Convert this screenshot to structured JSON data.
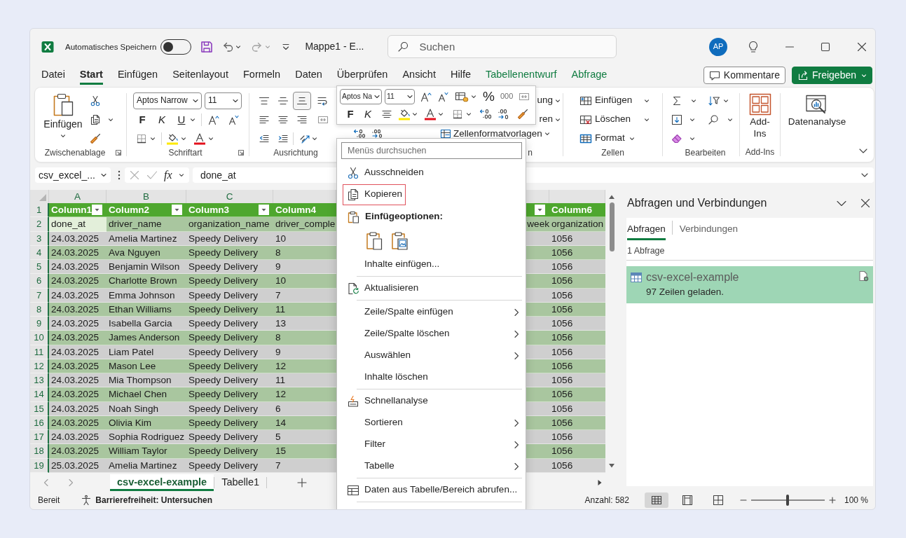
{
  "window": {
    "autosave": {
      "label": "Automatisches Speichern",
      "on": false
    },
    "title": "Mappe1 - E...",
    "search_placeholder": "Suchen",
    "avatar": "AP"
  },
  "ribbon_tabs": [
    {
      "label": "Datei",
      "kind": "standard",
      "selected": false
    },
    {
      "label": "Start",
      "kind": "standard",
      "selected": true
    },
    {
      "label": "Einfügen",
      "kind": "standard",
      "selected": false
    },
    {
      "label": "Seitenlayout",
      "kind": "standard",
      "selected": false
    },
    {
      "label": "Formeln",
      "kind": "standard",
      "selected": false
    },
    {
      "label": "Daten",
      "kind": "standard",
      "selected": false
    },
    {
      "label": "Überprüfen",
      "kind": "standard",
      "selected": false
    },
    {
      "label": "Ansicht",
      "kind": "standard",
      "selected": false
    },
    {
      "label": "Hilfe",
      "kind": "standard",
      "selected": false
    },
    {
      "label": "Tabellenentwurf",
      "kind": "contextual",
      "selected": false
    },
    {
      "label": "Abfrage",
      "kind": "contextual",
      "selected": false
    }
  ],
  "header_buttons": [
    {
      "label": "Kommentare",
      "kind": "outline"
    },
    {
      "label": "Freigeben",
      "kind": "primary"
    }
  ],
  "ribbon": {
    "clipboard": {
      "paste": "Einfügen",
      "label": "Zwischenablage"
    },
    "font": {
      "font_name": "Aptos Narrow",
      "font_size": "11",
      "bold": "F",
      "italic": "K",
      "underline": "U",
      "label": "Schriftart"
    },
    "alignment": {
      "vertical": [
        {
          "kind": "top",
          "selected": false
        },
        {
          "kind": "middle",
          "selected": false
        },
        {
          "kind": "bottom",
          "selected": true
        }
      ],
      "label": "Ausrichtung"
    },
    "styles": {
      "items": [
        "ung",
        "ren",
        "Zellenformatvorlagen"
      ],
      "label": "n"
    },
    "cells": {
      "items": [
        {
          "label": "Einfügen",
          "kind": "insert"
        },
        {
          "label": "Löschen",
          "kind": "delete"
        },
        {
          "label": "Format",
          "kind": "format"
        }
      ],
      "label": "Zellen"
    },
    "editing": {
      "label": "Bearbeiten"
    },
    "addins": {
      "lines": [
        "Add-",
        "Ins"
      ],
      "label": "Add-Ins"
    },
    "analysis": {
      "button": "Datenanalyse"
    }
  },
  "mini_toolbar": {
    "font_name": "Aptos Na",
    "font_size": "11",
    "percent": "%",
    "thousands": "000",
    "bold": "F",
    "italic": "K"
  },
  "formula_bar": {
    "name_box": "csv_excel_...",
    "fx": "fx",
    "value": "done_at"
  },
  "sheet": {
    "columns": [
      {
        "letter": "A",
        "header": "Column1",
        "filter": true
      },
      {
        "letter": "B",
        "header": "Column2",
        "filter": true
      },
      {
        "letter": "C",
        "header": "Column3",
        "filter": true
      },
      {
        "header": "Column4",
        "filter": false
      },
      {
        "filter": true
      },
      {
        "header": "Column6",
        "filter": false
      }
    ],
    "header_row_number": "1",
    "rows": [
      {
        "number": "2",
        "active": true,
        "cells": {
          "column_1": "done_at",
          "column_2": "driver_name",
          "column_3": "organization_name",
          "column_4": "driver_comple",
          "column_5": "week",
          "column_6": "organization"
        }
      },
      {
        "number": "3",
        "active": false,
        "cells": {
          "column_1": "24.03.2025",
          "column_2": "Amelia Martinez",
          "column_3": "Speedy Delivery",
          "column_4": "10",
          "column_6": "1056"
        }
      },
      {
        "number": "4",
        "active": false,
        "cells": {
          "column_1": "24.03.2025",
          "column_2": "Ava Nguyen",
          "column_3": "Speedy Delivery",
          "column_4": "8",
          "column_6": "1056"
        }
      },
      {
        "number": "5",
        "active": false,
        "cells": {
          "column_1": "24.03.2025",
          "column_2": "Benjamin Wilson",
          "column_3": "Speedy Delivery",
          "column_4": "9",
          "column_6": "1056"
        }
      },
      {
        "number": "6",
        "active": false,
        "cells": {
          "column_1": "24.03.2025",
          "column_2": "Charlotte Brown",
          "column_3": "Speedy Delivery",
          "column_4": "10",
          "column_6": "1056"
        }
      },
      {
        "number": "7",
        "active": false,
        "cells": {
          "column_1": "24.03.2025",
          "column_2": "Emma Johnson",
          "column_3": "Speedy Delivery",
          "column_4": "7",
          "column_6": "1056"
        }
      },
      {
        "number": "8",
        "active": false,
        "cells": {
          "column_1": "24.03.2025",
          "column_2": "Ethan Williams",
          "column_3": "Speedy Delivery",
          "column_4": "11",
          "column_6": "1056"
        }
      },
      {
        "number": "9",
        "active": false,
        "cells": {
          "column_1": "24.03.2025",
          "column_2": "Isabella Garcia",
          "column_3": "Speedy Delivery",
          "column_4": "13",
          "column_6": "1056"
        }
      },
      {
        "number": "10",
        "active": false,
        "cells": {
          "column_1": "24.03.2025",
          "column_2": "James Anderson",
          "column_3": "Speedy Delivery",
          "column_4": "8",
          "column_6": "1056"
        }
      },
      {
        "number": "11",
        "active": false,
        "cells": {
          "column_1": "24.03.2025",
          "column_2": "Liam Patel",
          "column_3": "Speedy Delivery",
          "column_4": "9",
          "column_6": "1056"
        }
      },
      {
        "number": "12",
        "active": false,
        "cells": {
          "column_1": "24.03.2025",
          "column_2": "Mason Lee",
          "column_3": "Speedy Delivery",
          "column_4": "12",
          "column_6": "1056"
        }
      },
      {
        "number": "13",
        "active": false,
        "cells": {
          "column_1": "24.03.2025",
          "column_2": "Mia Thompson",
          "column_3": "Speedy Delivery",
          "column_4": "11",
          "column_6": "1056"
        }
      },
      {
        "number": "14",
        "active": false,
        "cells": {
          "column_1": "24.03.2025",
          "column_2": "Michael Chen",
          "column_3": "Speedy Delivery",
          "column_4": "12",
          "column_6": "1056"
        }
      },
      {
        "number": "15",
        "active": false,
        "cells": {
          "column_1": "24.03.2025",
          "column_2": "Noah Singh",
          "column_3": "Speedy Delivery",
          "column_4": "6",
          "column_6": "1056"
        }
      },
      {
        "number": "16",
        "active": false,
        "cells": {
          "column_1": "24.03.2025",
          "column_2": "Olivia Kim",
          "column_3": "Speedy Delivery",
          "column_4": "14",
          "column_6": "1056"
        }
      },
      {
        "number": "17",
        "active": false,
        "cells": {
          "column_1": "24.03.2025",
          "column_2": "Sophia Rodriguez",
          "column_3": "Speedy Delivery",
          "column_4": "5",
          "column_6": "1056"
        }
      },
      {
        "number": "18",
        "active": false,
        "cells": {
          "column_1": "24.03.2025",
          "column_2": "William Taylor",
          "column_3": "Speedy Delivery",
          "column_4": "15",
          "column_6": "1056"
        }
      },
      {
        "number": "19",
        "active": false,
        "cells": {
          "column_1": "25.03.2025",
          "column_2": "Amelia Martinez",
          "column_3": "Speedy Delivery",
          "column_4": "7",
          "column_6": "1056"
        }
      }
    ]
  },
  "sheet_tabs": [
    {
      "label": "csv-excel-example",
      "selected": true
    },
    {
      "label": "Tabelle1",
      "selected": false
    }
  ],
  "queries_panel": {
    "title": "Abfragen und Verbindungen",
    "tabs": [
      {
        "label": "Abfragen",
        "selected": true
      },
      {
        "label": "Verbindungen",
        "selected": false
      }
    ],
    "count": "1 Abfrage",
    "queries": [
      {
        "name": "csv-excel-example",
        "status": "97 Zeilen geladen.",
        "selected": true
      }
    ]
  },
  "context_menu": {
    "search_placeholder": "Menüs durchsuchen",
    "items": [
      {
        "kind": "item",
        "label": "Ausschneiden",
        "submenu": false,
        "highlighted": false
      },
      {
        "kind": "item",
        "label": "Kopieren",
        "submenu": false,
        "highlighted": true
      },
      {
        "kind": "header",
        "label": "Einfügeoptionen:"
      },
      {
        "kind": "paste_options"
      },
      {
        "kind": "item",
        "label": "Inhalte einfügen...",
        "submenu": false,
        "highlighted": false
      },
      {
        "kind": "separator"
      },
      {
        "kind": "item",
        "label": "Aktualisieren",
        "submenu": false,
        "highlighted": false
      },
      {
        "kind": "separator"
      },
      {
        "kind": "item",
        "label": "Zeile/Spalte einfügen",
        "submenu": true,
        "highlighted": false
      },
      {
        "kind": "item",
        "label": "Zeile/Spalte löschen",
        "submenu": true,
        "highlighted": false
      },
      {
        "kind": "item",
        "label": "Auswählen",
        "submenu": true,
        "highlighted": false
      },
      {
        "kind": "item",
        "label": "Inhalte löschen",
        "submenu": false,
        "highlighted": false
      },
      {
        "kind": "separator"
      },
      {
        "kind": "item",
        "label": "Schnellanalyse",
        "submenu": false,
        "highlighted": false
      },
      {
        "kind": "item",
        "label": "Sortieren",
        "submenu": true,
        "highlighted": false
      },
      {
        "kind": "item",
        "label": "Filter",
        "submenu": true,
        "highlighted": false
      },
      {
        "kind": "item",
        "label": "Tabelle",
        "submenu": true,
        "highlighted": false
      },
      {
        "kind": "separator"
      },
      {
        "kind": "item",
        "label": "Daten aus Tabelle/Bereich abrufen...",
        "submenu": false,
        "highlighted": false
      },
      {
        "kind": "separator"
      }
    ]
  },
  "status_bar": {
    "ready": "Bereit",
    "accessibility": "Barrierefreiheit: Untersuchen",
    "count": "Anzahl: 582",
    "views": [
      {
        "kind": "normal",
        "selected": true
      },
      {
        "kind": "page_layout",
        "selected": false
      },
      {
        "kind": "page_break",
        "selected": false
      }
    ],
    "zoom": {
      "level": 0.5,
      "reading": "100 %"
    }
  }
}
